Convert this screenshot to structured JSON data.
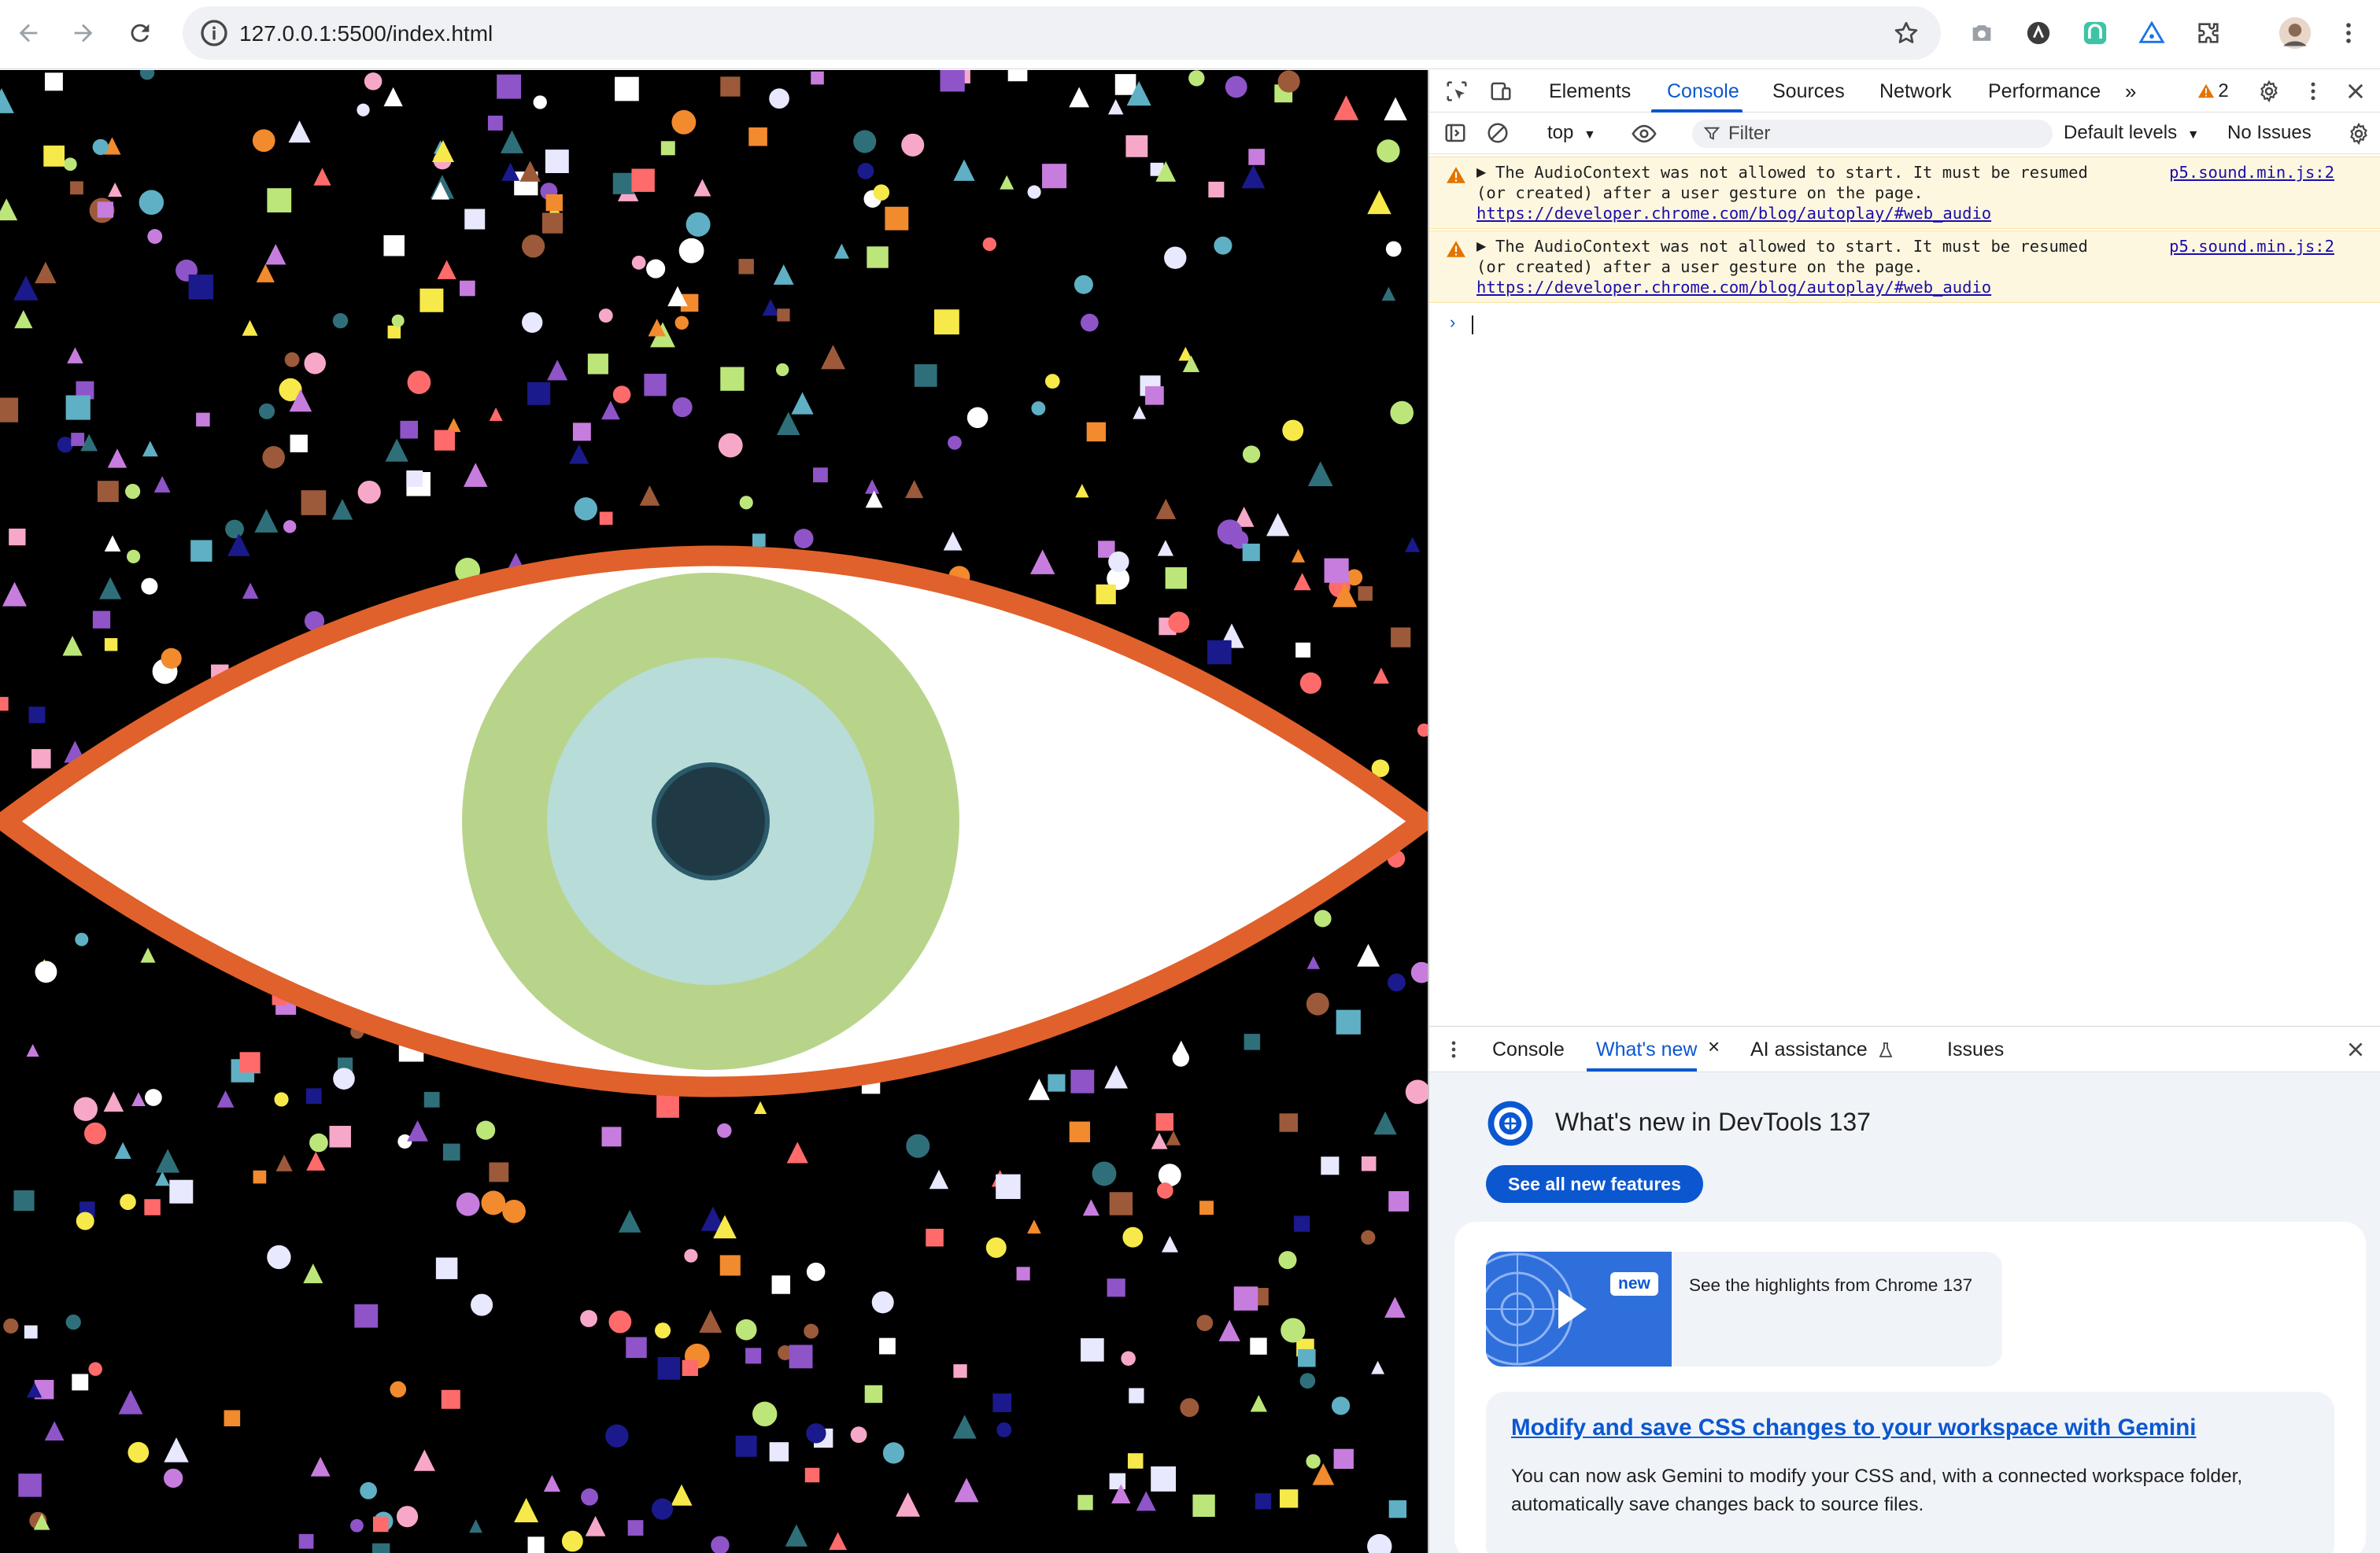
{
  "browser": {
    "url": "127.0.0.1:5500/index.html"
  },
  "devtools": {
    "tabs": [
      "Elements",
      "Console",
      "Sources",
      "Network",
      "Performance"
    ],
    "active_tab": "Console",
    "warning_count": "2",
    "context": "top",
    "filter_placeholder": "Filter",
    "levels": "Default levels",
    "issues": "No Issues",
    "messages": [
      {
        "line1": "The AudioContext was not allowed to start. It must be resumed",
        "line2": "(or created) after a user gesture on the page.",
        "link": "https://developer.chrome.com/blog/autoplay/#web_audio",
        "source": "p5.sound.min.js:2"
      },
      {
        "line1": "The AudioContext was not allowed to start. It must be resumed",
        "line2": "(or created) after a user gesture on the page.",
        "link": "https://developer.chrome.com/blog/autoplay/#web_audio",
        "source": "p5.sound.min.js:2"
      }
    ],
    "drawer": {
      "tabs": [
        "Console",
        "What's new",
        "AI assistance",
        "Issues"
      ],
      "active_tab": "What's new",
      "whats_new_title": "What's new in DevTools 137",
      "see_all_button": "See all new features",
      "highlight_badge": "new",
      "highlight_text": "See the highlights from Chrome 137",
      "feature_title": "Modify and save CSS changes to your workspace with Gemini",
      "feature_desc": "You can now ask Gemini to modify your CSS and, with a connected workspace folder, automatically save changes back to source files."
    }
  },
  "colors": {
    "accent": "#0b57d0",
    "eye_outline": "#e0612b",
    "iris_outer": "#b8d48a",
    "iris_inner": "#b8dcd8",
    "pupil": "#1f3a45",
    "confetti": [
      "#ff6b6b",
      "#f7a8c8",
      "#c77dde",
      "#8e54c8",
      "#f7e94a",
      "#ffffff",
      "#5fb0c4",
      "#2f6f7a",
      "#bde67a",
      "#f28a2e",
      "#1a1a8c",
      "#9c5a3a",
      "#e8e8ff"
    ]
  }
}
